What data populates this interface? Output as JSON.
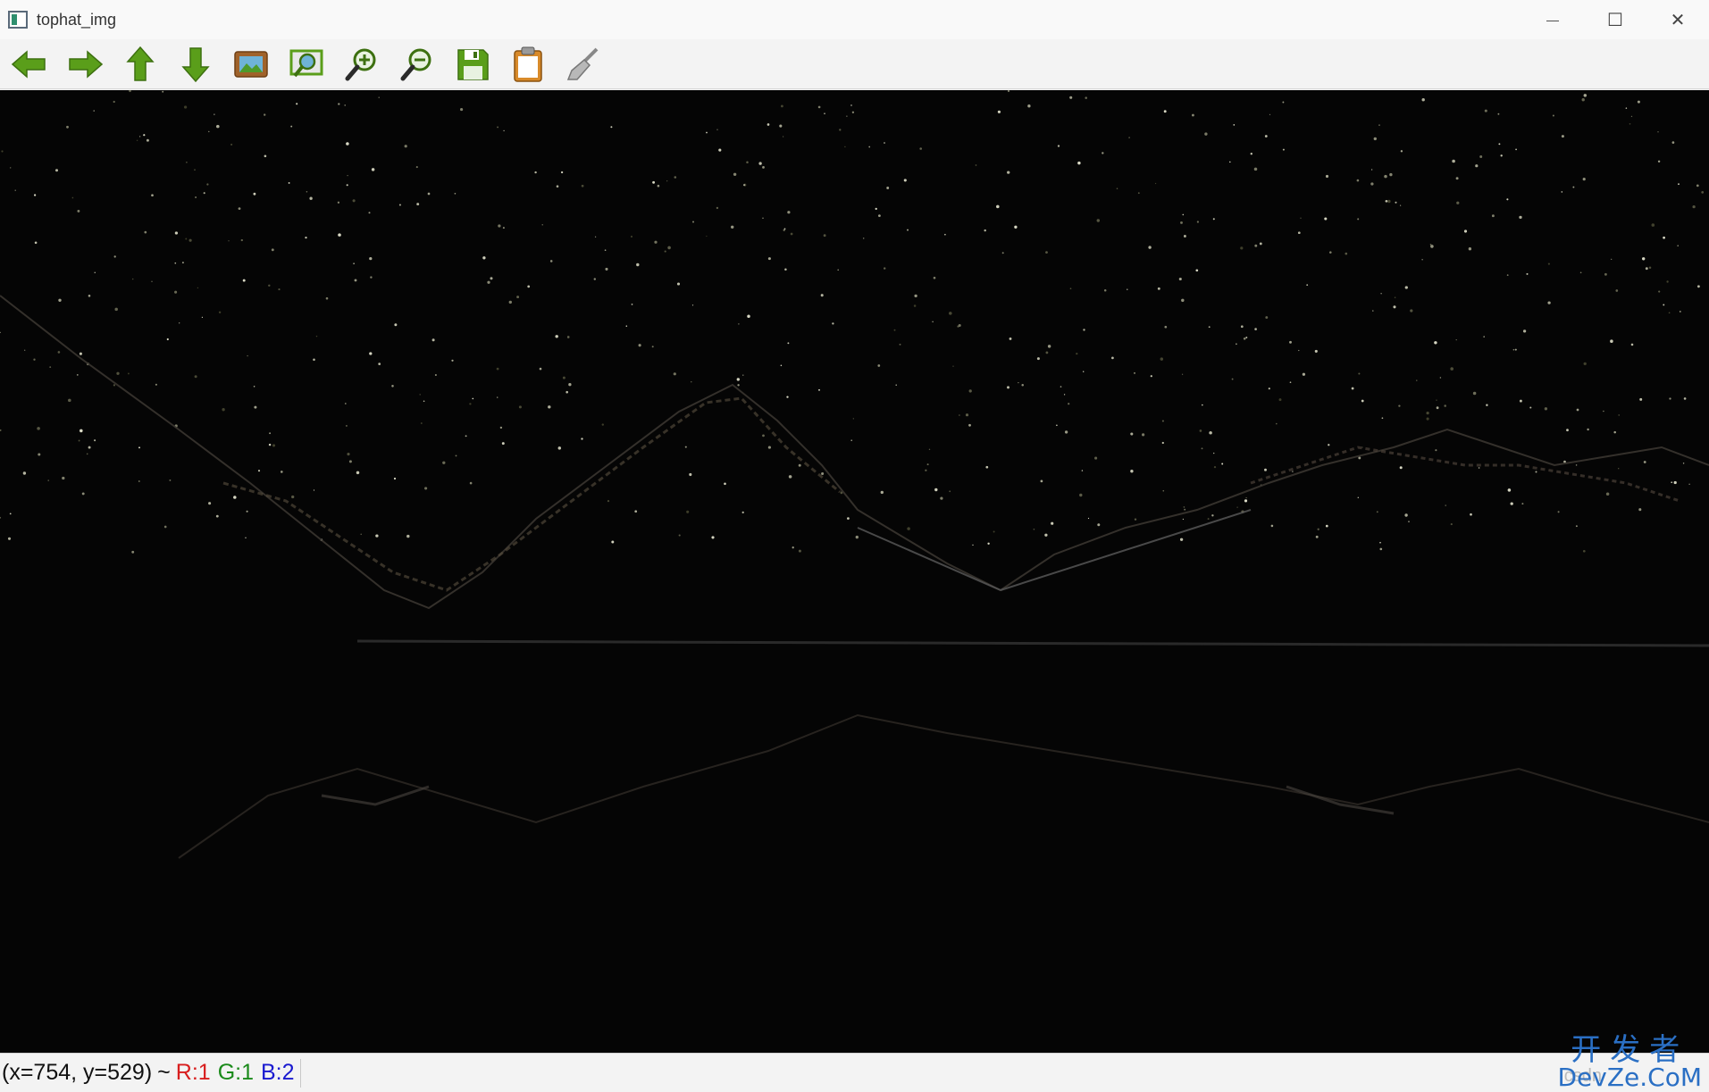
{
  "window": {
    "title": "tophat_img",
    "controls": {
      "minimize": "—",
      "maximize": "☐",
      "close": "✕"
    }
  },
  "toolbar": {
    "items": [
      {
        "name": "pan-left",
        "icon": "arrow-left-icon"
      },
      {
        "name": "pan-right",
        "icon": "arrow-right-icon"
      },
      {
        "name": "pan-up",
        "icon": "arrow-up-icon"
      },
      {
        "name": "pan-down",
        "icon": "arrow-down-icon"
      },
      {
        "name": "zoom-original",
        "icon": "image-icon"
      },
      {
        "name": "zoom-fit",
        "icon": "zoom-fit-icon"
      },
      {
        "name": "zoom-in",
        "icon": "zoom-in-icon"
      },
      {
        "name": "zoom-out",
        "icon": "zoom-out-icon"
      },
      {
        "name": "save",
        "icon": "save-icon"
      },
      {
        "name": "copy-clipboard",
        "icon": "clipboard-icon"
      },
      {
        "name": "properties",
        "icon": "brush-icon"
      }
    ],
    "colors": {
      "green": "#5a9e1a",
      "brown": "#a0622a",
      "orange": "#d88a2a"
    }
  },
  "status": {
    "coords": "(x=754, y=529)",
    "separator": "~",
    "r": "R:1",
    "g": "G:1",
    "b": "B:2",
    "colors": {
      "r": "#d81e1e",
      "g": "#1a8a1a",
      "b": "#1a1ad0"
    }
  },
  "watermark": {
    "cn": "开发者",
    "en": "DevZe.CoM",
    "small": "csdn"
  }
}
